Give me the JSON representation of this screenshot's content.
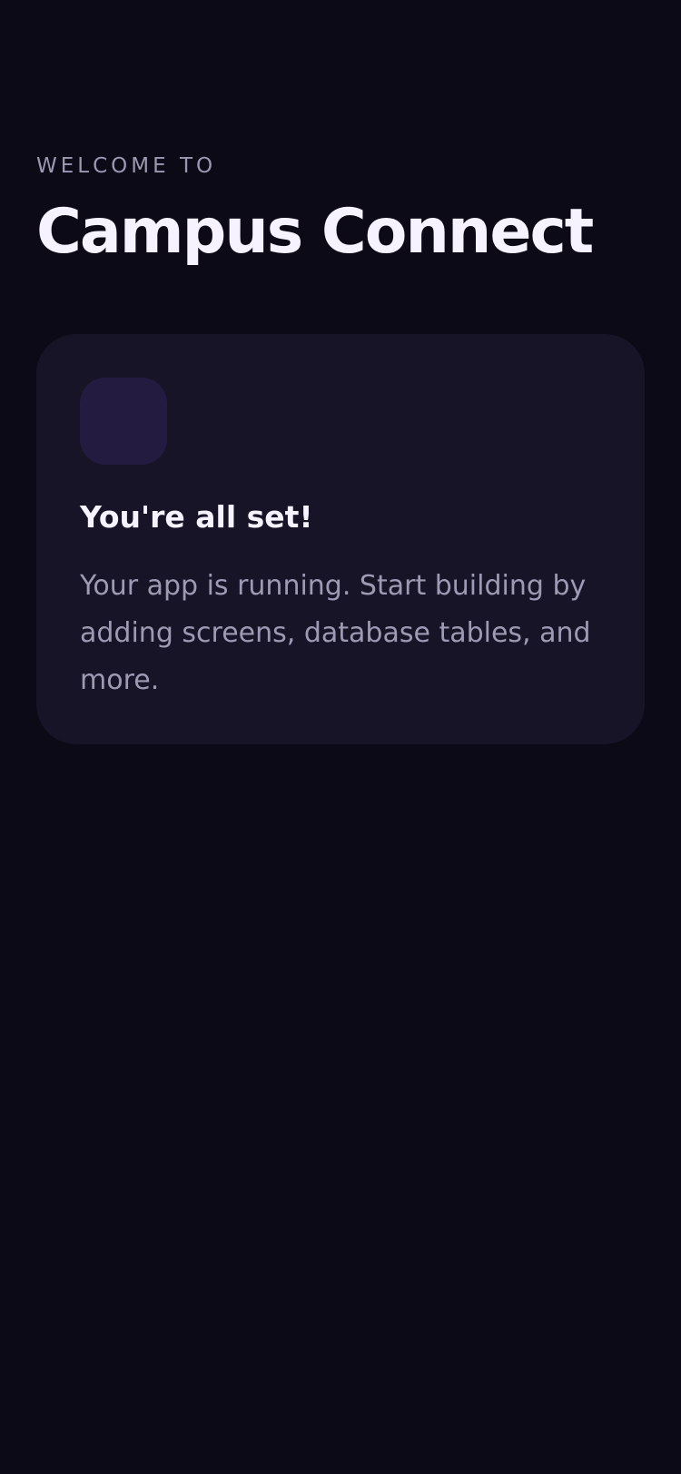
{
  "header": {
    "eyebrow": "WELCOME TO",
    "title": "Campus Connect"
  },
  "card": {
    "icon": "app-icon-tile",
    "heading": "You're all set!",
    "body": "Your app is running. Start building by adding screens, database tables, and more."
  },
  "colors": {
    "background": "#0b0a16",
    "card_background": "#181428",
    "icon_tile": "#241b40",
    "primary_text": "#f6f2ff",
    "secondary_text": "#9f9ab4"
  }
}
